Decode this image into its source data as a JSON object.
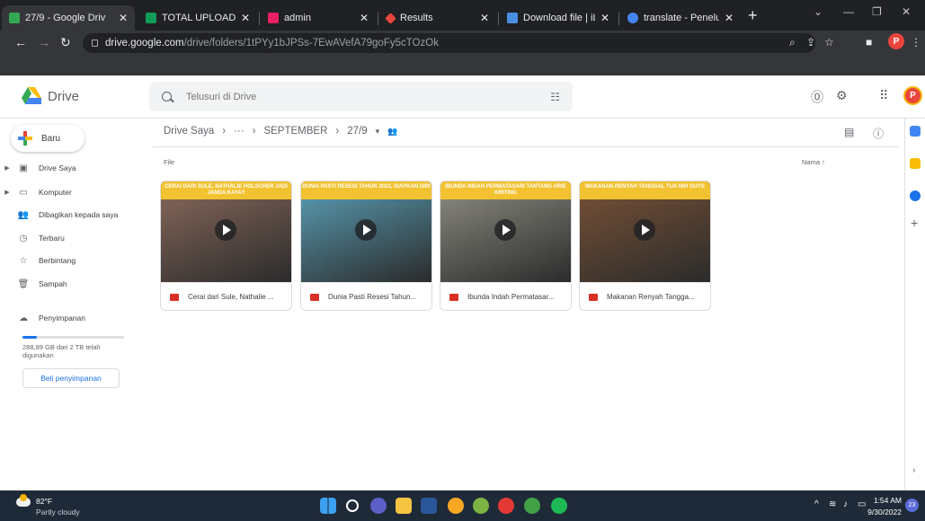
{
  "browser": {
    "tabs": [
      {
        "title": "27/9 - Google Driv",
        "color": "#34a853"
      },
      {
        "title": "TOTAL UPLOAD KO",
        "color": "#0f9d58"
      },
      {
        "title": "admin",
        "color": "#e91e63"
      },
      {
        "title": "Results",
        "color": "#e8453c"
      },
      {
        "title": "Download file | iLo",
        "color": "#4a90e2"
      },
      {
        "title": "translate - Penelus",
        "color": "#4285f4"
      }
    ],
    "url_host": "drive.google.com",
    "url_path": "/drive/folders/1tPYy1bJPSs-7EwAVefA79goFy5cTOzOk",
    "profile_initial": "P"
  },
  "drive": {
    "brand": "Drive",
    "search_placeholder": "Telusuri di Drive",
    "avatar_initial": "P"
  },
  "sidebar": {
    "new_label": "Baru",
    "items": [
      {
        "label": "Drive Saya",
        "icon": "drive-icon"
      },
      {
        "label": "Komputer",
        "icon": "computer-icon"
      },
      {
        "label": "Dibagikan kepada saya",
        "icon": "shared-icon"
      },
      {
        "label": "Terbaru",
        "icon": "clock-icon"
      },
      {
        "label": "Berbintang",
        "icon": "star-icon"
      },
      {
        "label": "Sampah",
        "icon": "trash-icon"
      }
    ],
    "storage_label": "Penyimpanan",
    "storage_used_text": "288,89 GB dari 2 TB telah digunakan",
    "storage_used_fraction": 0.14,
    "buy_storage": "Beli penyimpanan"
  },
  "main": {
    "breadcrumb": [
      "Drive Saya",
      "···",
      "SEPTEMBER",
      "27/9"
    ],
    "section_label": "File",
    "sort_label": "Nama",
    "files": [
      {
        "name": "Cerai dari Sule, Nathalie ...",
        "banner": "CERAI DARI SULE, NATHALIE HOLSCHER JADI JANDA KAYA?",
        "bg": "#8a6a5c"
      },
      {
        "name": "Dunia Pasti Resesi Tahun...",
        "banner": "DUNIA PASTI RESESI TAHUN 2023, SIAPKAN DIRI",
        "bg": "#5aa0b8"
      },
      {
        "name": "Ibunda Indah Permatasar...",
        "banner": "IBUNDA INDAH PERMATASARI TANTANG ARIE KRITING",
        "bg": "#8f8f84"
      },
      {
        "name": "Makanan Renyah Tangga...",
        "banner": "MAKANAN RENYAH TANGGAL TUA NIH GUYS",
        "bg": "#7a5236"
      }
    ]
  },
  "taskbar": {
    "temperature": "82°F",
    "weather": "Partly cloudy",
    "time": "1:54 AM",
    "date": "9/30/2022",
    "notification_count": "23"
  }
}
